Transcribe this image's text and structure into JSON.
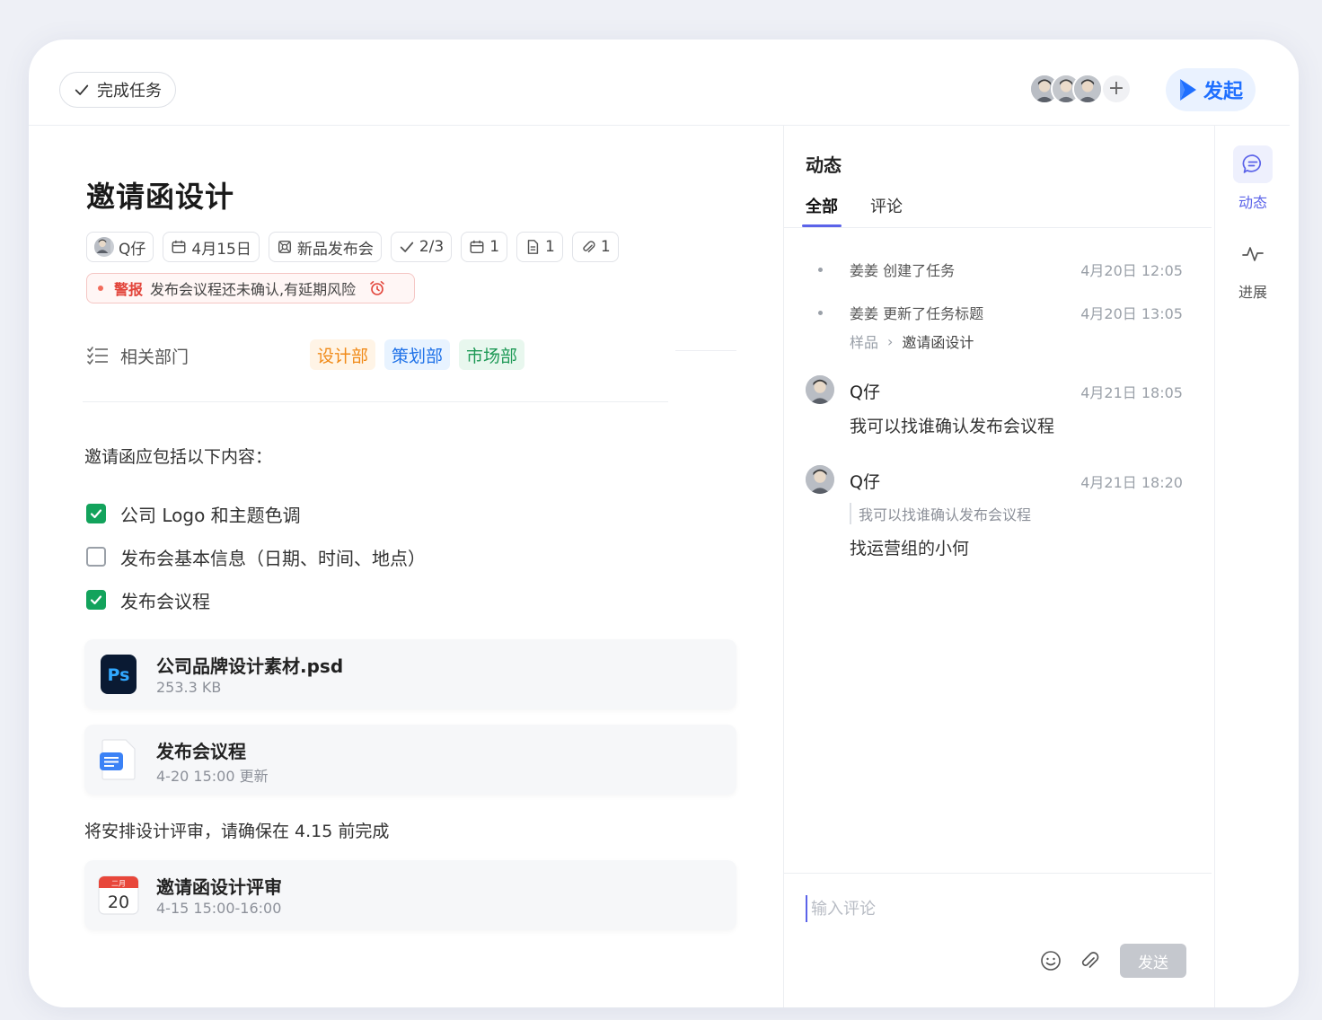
{
  "topbar": {
    "complete_label": "完成任务",
    "launch_label": "发起",
    "add_member_symbol": "+",
    "member_count": 3
  },
  "task": {
    "title": "邀请函设计",
    "meta": {
      "assignee": "Q仔",
      "due_date": "4月15日",
      "project": "新品发布会",
      "subtasks": "2/3",
      "calendar_count": "1",
      "doc_count": "1",
      "attachment_count": "1"
    },
    "alert": {
      "tag": "警报",
      "message": "发布会议程还未确认,有延期风险"
    },
    "department": {
      "label": "相关部门",
      "tags": [
        "设计部",
        "策划部",
        "市场部"
      ],
      "tag_colors": [
        "#f08a18",
        "#1f72e8",
        "#1f9a57"
      ]
    },
    "intro": "邀请函应包括以下内容：",
    "checklist": [
      {
        "text": "公司 Logo 和主题色调",
        "checked": true
      },
      {
        "text": "发布会基本信息（日期、时间、地点）",
        "checked": false
      },
      {
        "text": "发布会议程",
        "checked": true
      }
    ],
    "files": [
      {
        "name": "公司品牌设计素材.psd",
        "meta": "253.3 KB",
        "icon": "photoshop-file-icon",
        "icon_text": "Ps"
      },
      {
        "name": "发布会议程",
        "meta": "4-20 15:00 更新",
        "icon": "doc-file-icon"
      }
    ],
    "note": "将安排设计评审，请确保在 4.15 前完成",
    "event": {
      "name": "邀请函设计评审",
      "time": "4-15 15:00-16:00",
      "cal_month": "二月",
      "cal_day": "20"
    }
  },
  "activity": {
    "title": "动态",
    "tabs": [
      "全部",
      "评论"
    ],
    "logs": [
      {
        "text": "姜姜 创建了任务",
        "time": "4月20日 12:05"
      },
      {
        "text": "姜姜 更新了任务标题",
        "time": "4月20日 13:05",
        "path_from": "样品",
        "path_sep": "›",
        "path_to": "邀请函设计"
      }
    ],
    "comments": [
      {
        "name": "Q仔",
        "time": "4月21日 18:05",
        "body": "我可以找谁确认发布会议程"
      },
      {
        "name": "Q仔",
        "time": "4月21日 18:20",
        "quote": "我可以找谁确认发布会议程",
        "body": "找运营组的小何"
      }
    ],
    "composer": {
      "placeholder": "输入评论",
      "send_label": "发送"
    }
  },
  "rail": {
    "items": [
      {
        "label": "动态",
        "icon": "comment-icon",
        "active": true
      },
      {
        "label": "进展",
        "icon": "activity-pulse-icon",
        "active": false
      }
    ]
  },
  "colors": {
    "accent": "#5b63e9",
    "primary_blue": "#1f6fff",
    "success_green": "#13a35c",
    "alert_red": "#e2443a"
  }
}
